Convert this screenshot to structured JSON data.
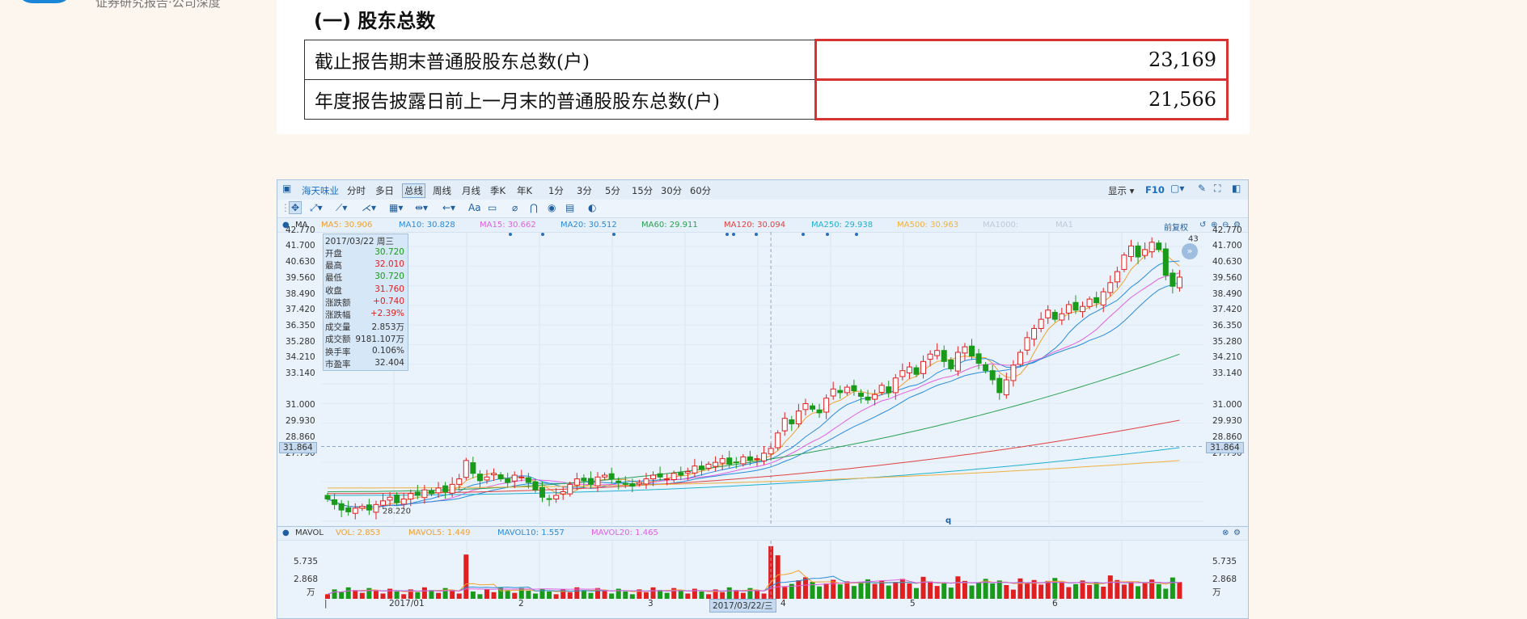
{
  "logo_text": "证券研究报告·公司深度",
  "doc": {
    "title": "(一) 股东总数",
    "rows": [
      {
        "label": "截止报告期末普通股股东总数(户)",
        "value": "23,169"
      },
      {
        "label": "年度报告披露日前上一月末的普通股股东总数(户)",
        "value": "21,566"
      }
    ]
  },
  "chart_panel": {
    "stock_name": "海天味业",
    "tabs": [
      "分时",
      "多日",
      "总线",
      "周线",
      "月线",
      "季K",
      "年K",
      "1分",
      "3分",
      "5分",
      "15分",
      "30分",
      "60分"
    ],
    "active_tab": "总线",
    "display_label": "显示",
    "f10_label": "F10",
    "ma_label": "MA",
    "ma_legend": [
      {
        "text": "MA5: 30.906",
        "color": "#f0a030"
      },
      {
        "text": "MA10: 30.828",
        "color": "#2a8ad8"
      },
      {
        "text": "MA15: 30.662",
        "color": "#e060e0"
      },
      {
        "text": "MA20: 30.512",
        "color": "#2a8ad8"
      },
      {
        "text": "MA60: 29.911",
        "color": "#2aa050"
      },
      {
        "text": "MA120: 30.094",
        "color": "#e04040"
      },
      {
        "text": "MA250: 29.938",
        "color": "#20b0d0"
      },
      {
        "text": "MA500: 30.963",
        "color": "#f0b040"
      },
      {
        "text": "MA1000:",
        "color": "#c0c8d8"
      },
      {
        "text": "MA1",
        "color": "#c0c8d8"
      }
    ],
    "fuquan_label": "前复权",
    "price_axis": [
      "42.770",
      "41.700",
      "40.630",
      "39.560",
      "38.490",
      "37.420",
      "36.350",
      "35.280",
      "34.210",
      "33.140",
      "31.000",
      "29.930",
      "28.860",
      "27.790"
    ],
    "crosshair_price": "31.864",
    "min_label": "28.220",
    "max_label": "43",
    "info": {
      "date": "2017/03/22 周三",
      "rows": [
        {
          "k": "开盘",
          "v": "30.720",
          "color": "#1a9a1a"
        },
        {
          "k": "最高",
          "v": "32.010",
          "color": "#e02020"
        },
        {
          "k": "最低",
          "v": "30.720",
          "color": "#1a9a1a"
        },
        {
          "k": "收盘",
          "v": "31.760",
          "color": "#e02020"
        },
        {
          "k": "涨跌额",
          "v": "+0.740",
          "color": "#e02020"
        },
        {
          "k": "涨跌幅",
          "v": "+2.39%",
          "color": "#e02020"
        },
        {
          "k": "成交量",
          "v": "2.853万",
          "color": "#333333"
        },
        {
          "k": "成交额",
          "v": "9181.107万",
          "color": "#333333"
        },
        {
          "k": "换手率",
          "v": "0.106%",
          "color": "#333333"
        },
        {
          "k": "市盈率",
          "v": "32.404",
          "color": "#333333"
        }
      ]
    },
    "vol": {
      "label": "MAVOL",
      "legend": [
        {
          "text": "VOL: 2.853",
          "color": "#f0a030"
        },
        {
          "text": "MAVOL5: 1.449",
          "color": "#f0a030"
        },
        {
          "text": "MAVOL10: 1.557",
          "color": "#2a8ad8"
        },
        {
          "text": "MAVOL20: 1.465",
          "color": "#e060e0"
        }
      ],
      "axis": [
        "5.735",
        "2.868",
        "万"
      ]
    },
    "date_axis": [
      {
        "text": "2017/01"
      },
      {
        "text": "2"
      },
      {
        "text": "3"
      },
      {
        "text": "2017/03/22/三"
      },
      {
        "text": "4"
      },
      {
        "text": "5"
      },
      {
        "text": "6"
      }
    ],
    "marker_q": "q"
  },
  "chart_data": {
    "type": "candlestick",
    "x_axis": [
      "2017/01",
      "2",
      "3",
      "4",
      "5",
      "6"
    ],
    "ylim": [
      27.79,
      43.3
    ],
    "closes": [
      29.0,
      28.7,
      28.4,
      28.3,
      28.5,
      28.6,
      28.4,
      28.7,
      28.9,
      29.1,
      28.8,
      29.0,
      29.3,
      29.2,
      29.5,
      29.3,
      29.6,
      29.4,
      29.8,
      30.1,
      31.1,
      30.4,
      30.0,
      30.2,
      30.4,
      30.1,
      29.9,
      30.3,
      30.2,
      29.9,
      29.5,
      29.1,
      29.0,
      29.2,
      29.4,
      29.8,
      30.1,
      30.0,
      29.8,
      30.2,
      30.3,
      30.1,
      29.9,
      29.8,
      29.7,
      29.9,
      30.1,
      30.3,
      30.2,
      30.1,
      30.4,
      30.3,
      30.5,
      30.8,
      30.6,
      30.9,
      31.0,
      31.2,
      30.9,
      31.0,
      31.3,
      31.1,
      31.2,
      31.5,
      31.76,
      32.6,
      33.4,
      33.1,
      33.8,
      34.2,
      33.9,
      33.7,
      34.5,
      35.0,
      34.8,
      35.1,
      34.9,
      34.6,
      34.4,
      34.7,
      35.2,
      34.8,
      35.6,
      36.0,
      36.2,
      35.8,
      36.5,
      36.9,
      37.1,
      36.5,
      36.1,
      37.0,
      37.3,
      36.8,
      36.4,
      36.0,
      35.5,
      34.8,
      35.5,
      36.3,
      37.0,
      37.8,
      38.3,
      38.8,
      39.3,
      38.8,
      39.1,
      39.6,
      39.3,
      39.5,
      39.9,
      39.7,
      40.3,
      40.8,
      41.4,
      42.3,
      42.8,
      42.2,
      42.6,
      43.0,
      42.6,
      41.2,
      40.6,
      41.1
    ]
  }
}
